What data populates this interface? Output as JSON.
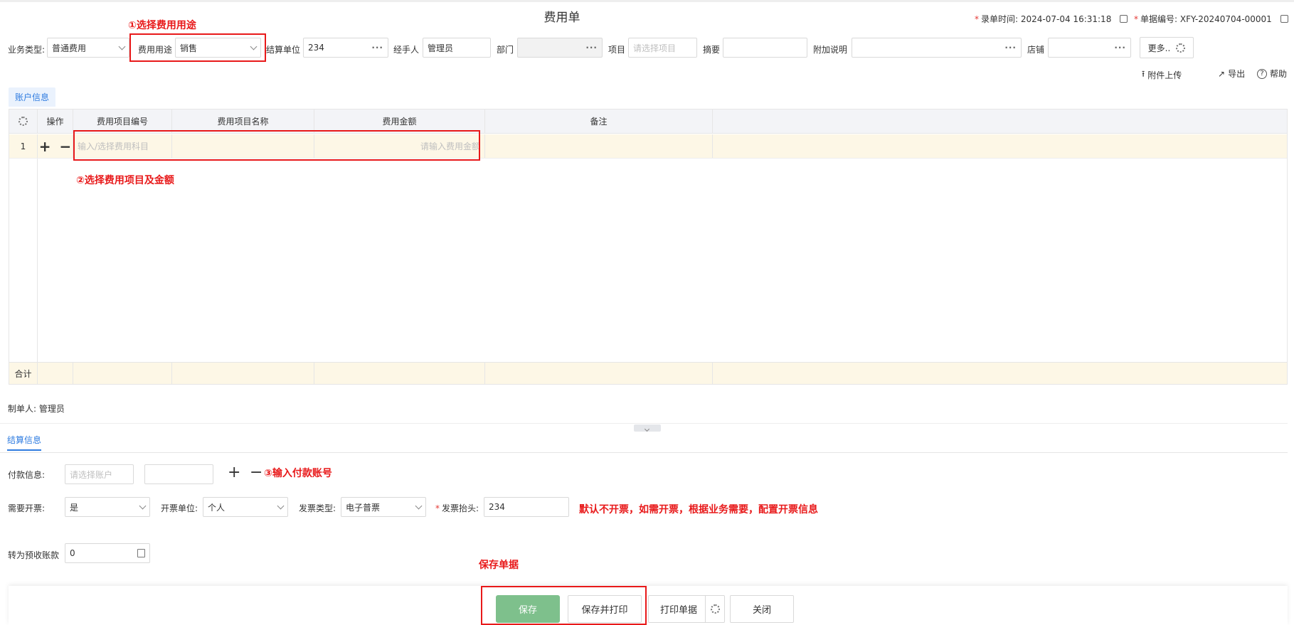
{
  "page": {
    "title": "费用单",
    "record_time_label": "录单时间:",
    "record_time": "2024-07-04 16:31:18",
    "doc_no_label": "单据编号:",
    "doc_no": "XFY-20240704-00001"
  },
  "form": {
    "biz_type_label": "业务类型:",
    "biz_type": "普通费用",
    "purpose_label": "费用用途",
    "purpose": "销售",
    "settle_unit_label": "结算单位",
    "settle_unit": "234",
    "handler_label": "经手人",
    "handler": "管理员",
    "dept_label": "部门",
    "project_label": "项目",
    "project_placeholder": "请选择项目",
    "summary_label": "摘要",
    "extra_note_label": "附加说明",
    "store_label": "店铺",
    "more_label": "更多.."
  },
  "actions": {
    "upload": "附件上传",
    "export": "导出",
    "help": "帮助"
  },
  "tabs": {
    "account_info": "账户信息",
    "settle_info": "结算信息"
  },
  "grid": {
    "headers": [
      "操作",
      "费用项目编号",
      "费用项目名称",
      "费用金额",
      "备注"
    ],
    "row_index": "1",
    "add": "+",
    "remove": "−",
    "code_placeholder": "输入/选择费用科目",
    "amount_placeholder": "请输入费用金额",
    "total_label": "合计"
  },
  "creator": {
    "label": "制单人:",
    "name": "管理员"
  },
  "settle": {
    "payment_label": "付款信息:",
    "account_placeholder": "请选择账户",
    "invoice_needed_label": "需要开票:",
    "invoice_needed": "是",
    "invoice_unit_label": "开票单位:",
    "invoice_unit": "个人",
    "invoice_type_label": "发票类型:",
    "invoice_type": "电子普票",
    "invoice_title_label": "发票抬头:",
    "invoice_title": "234",
    "prepay_label": "转为预收账款",
    "prepay_value": "0"
  },
  "buttons": {
    "save": "保存",
    "save_print": "保存并打印",
    "print": "打印单据",
    "close": "关闭"
  },
  "annotations": {
    "step1": "①选择费用用途",
    "step2": "②选择费用项目及金额",
    "step3": "③输入付款账号",
    "invoice_note": "默认不开票，如需开票，根据业务需要，配置开票信息",
    "save_note": "保存单据"
  },
  "colors": {
    "primary": "#2f7ce0",
    "save_button": "#7ec08c",
    "annotation_red": "#e8191a",
    "row_highlight": "#fdf7e6"
  }
}
